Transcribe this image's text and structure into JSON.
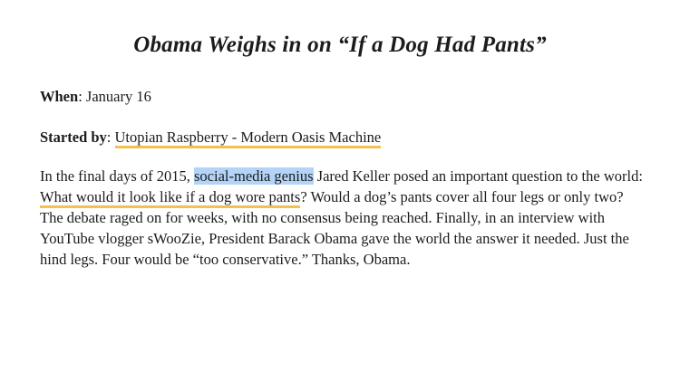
{
  "article": {
    "title": "Obama Weighs in on “If a Dog Had Pants”",
    "when_label": "When",
    "when_value": "January 16",
    "started_label": "Started by",
    "started_link": "Utopian Raspberry - Modern Oasis Machine",
    "body": {
      "part1": "In the final days of 2015, ",
      "highlight": "social-media genius",
      "part2": " Jared Keller posed an important question to the world: ",
      "link": "What would it look like if a dog wore pants",
      "part3": "? Would a dog’s pants cover all four legs or only two? The debate raged on for weeks, with no consensus being reached. Finally, in an interview with YouTube vlogger sWooZie, President Barack Obama gave the world the answer it needed. Just the hind legs. Four would be “too conservative.” Thanks, Obama."
    }
  },
  "colors": {
    "link_underline": "#f2c14e",
    "selection_highlight": "#b3d4f8",
    "text": "#1c1c1c"
  }
}
